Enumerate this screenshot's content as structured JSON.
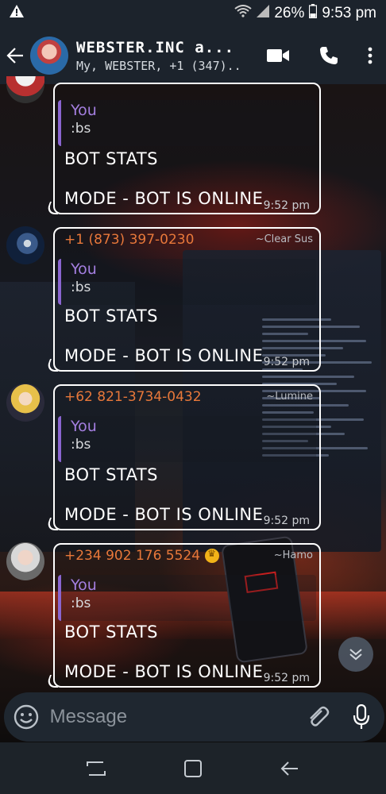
{
  "status_bar": {
    "battery": "26%",
    "time": "9:53 pm"
  },
  "header": {
    "title": "WEBSTER.INC a...",
    "subtitle": "My, WEBSTER, +1 (347)..."
  },
  "messages": [
    {
      "sender": "",
      "pushname": "",
      "quote_author": "You",
      "quote_text": ":bs",
      "line1": "BOT STATS",
      "line2": "MODE - BOT IS ONLINE",
      "time": "9:52 pm"
    },
    {
      "sender": "+1 (873) 397-0230",
      "pushname": "~Clear Sus",
      "quote_author": "You",
      "quote_text": ":bs",
      "line1": "BOT STATS",
      "line2": "MODE - BOT IS ONLINE",
      "time": "9:52 pm"
    },
    {
      "sender": "+62 821-3734-0432",
      "pushname": "~Lumine",
      "quote_author": "You",
      "quote_text": ":bs",
      "line1": "BOT STATS",
      "line2": "MODE - BOT IS ONLINE",
      "time": "9:52 pm"
    },
    {
      "sender": "+234 902 176 5524",
      "pushname": "~Hamo",
      "quote_author": "You",
      "quote_text": ":bs",
      "line1": "BOT STATS",
      "line2": "MODE - BOT IS ONLINE",
      "time": "9:52 pm"
    }
  ],
  "composer": {
    "placeholder": "Message"
  },
  "colors": {
    "sender": "#e8783a",
    "quote_bar": "#8a65d0",
    "bar_bg": "#1c232c"
  }
}
